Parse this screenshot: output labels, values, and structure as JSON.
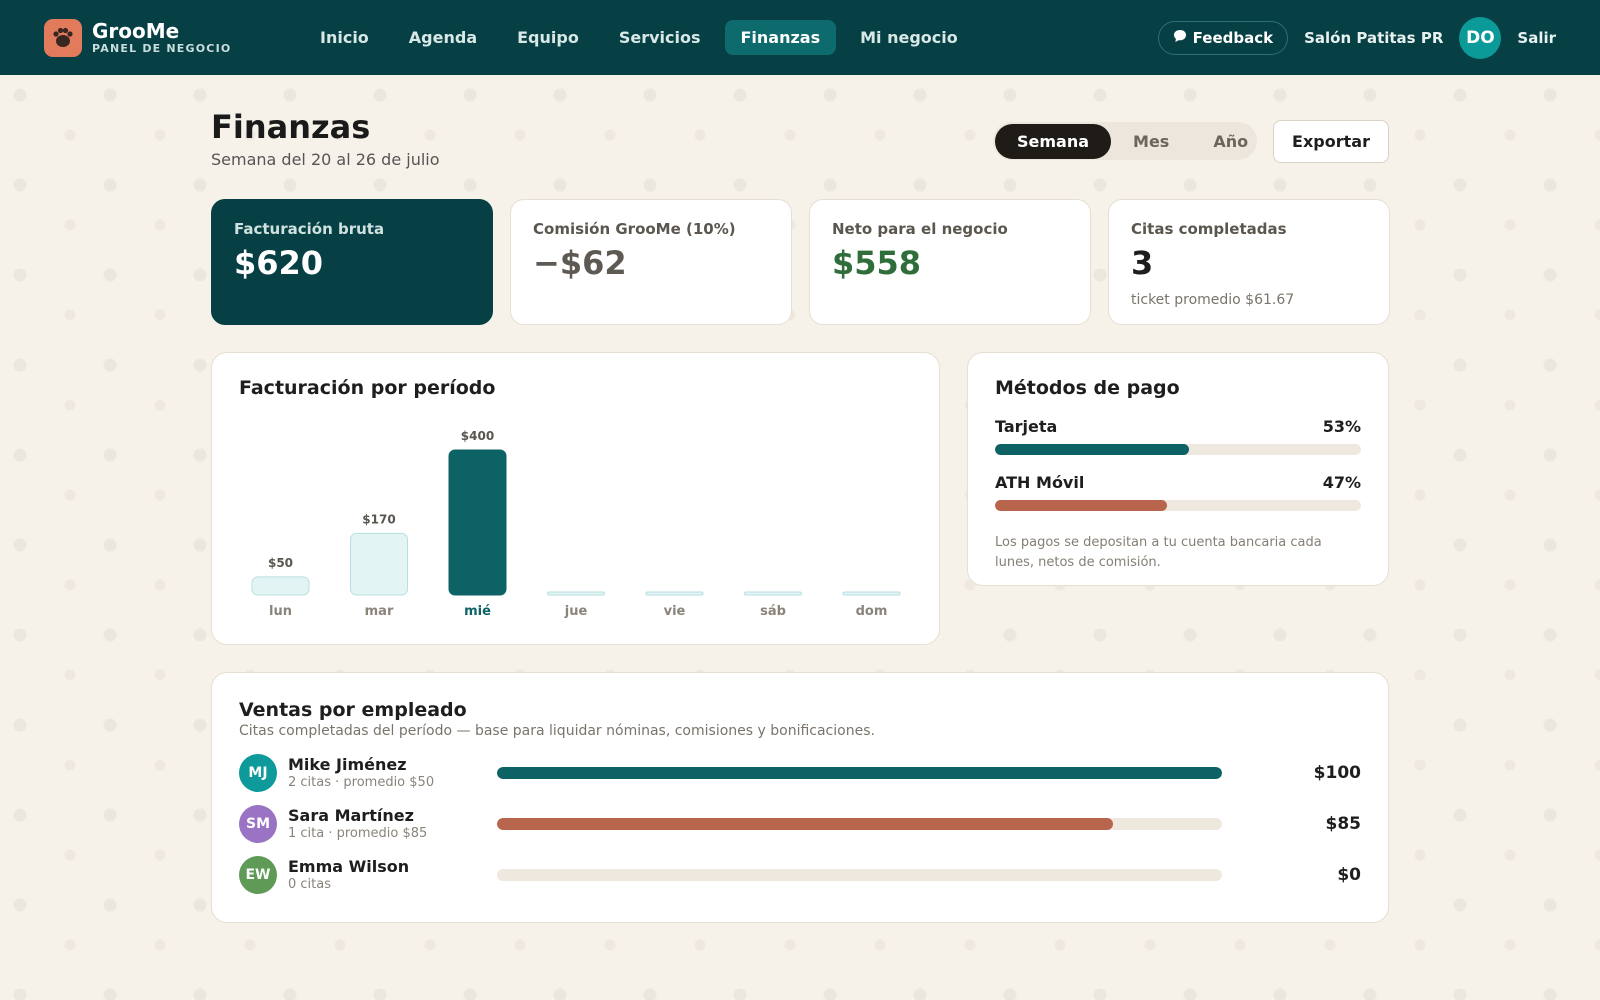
{
  "brand": {
    "name": "GrooMe",
    "subtitle": "PANEL DE NEGOCIO"
  },
  "nav": [
    {
      "label": "Inicio",
      "active": false
    },
    {
      "label": "Agenda",
      "active": false
    },
    {
      "label": "Equipo",
      "active": false
    },
    {
      "label": "Servicios",
      "active": false
    },
    {
      "label": "Finanzas",
      "active": true
    },
    {
      "label": "Mi negocio",
      "active": false
    }
  ],
  "topbar": {
    "feedback_label": "Feedback",
    "feedback_icon": "chat-bubble-icon",
    "business_name": "Salón Patitas PR",
    "avatar_initials": "DO",
    "logout_label": "Salir"
  },
  "page": {
    "title": "Finanzas",
    "subtitle": "Semana del 20 al 26 de julio",
    "period_options": [
      {
        "label": "Semana",
        "active": true
      },
      {
        "label": "Mes",
        "active": false
      },
      {
        "label": "Año",
        "active": false
      }
    ],
    "export_label": "Exportar"
  },
  "kpis": [
    {
      "label": "Facturación bruta",
      "value": "$620",
      "note": ""
    },
    {
      "label": "Comisión GrooMe (10%)",
      "value": "−$62",
      "note": ""
    },
    {
      "label": "Neto para el negocio",
      "value": "$558",
      "note": ""
    },
    {
      "label": "Citas completadas",
      "value": "3",
      "note": "ticket promedio $61.67"
    }
  ],
  "colors": {
    "primary": "#063f44",
    "teal": "#0d6266",
    "teal_light": "#e3f4f4",
    "terracotta": "#b9654d",
    "net_green": "#2f6e3a",
    "commission_gray": "#5e5a53"
  },
  "chart_data": {
    "type": "bar",
    "title": "Facturación por período",
    "categories": [
      "lun",
      "mar",
      "mié",
      "jue",
      "vie",
      "sáb",
      "dom"
    ],
    "values": [
      50,
      170,
      400,
      0,
      0,
      0,
      0
    ],
    "value_labels": [
      "$50",
      "$170",
      "$400",
      "",
      "",
      "",
      ""
    ],
    "highlight_index": 2,
    "ylim": [
      0,
      400
    ],
    "grid": false
  },
  "payments": {
    "title": "Métodos de pago",
    "methods": [
      {
        "name": "Tarjeta",
        "percent_label": "53%",
        "percent": 53,
        "color": "#0d6266"
      },
      {
        "name": "ATH Móvil",
        "percent_label": "47%",
        "percent": 47,
        "color": "#b9654d"
      }
    ],
    "note": "Los pagos se depositan a tu cuenta bancaria cada lunes, netos de comisión."
  },
  "employees": {
    "title": "Ventas por empleado",
    "subtitle": "Citas completadas del período — base para liquidar nóminas, comisiones y bonificaciones.",
    "max_amount": 100,
    "rows": [
      {
        "initials": "MJ",
        "name": "Mike Jiménez",
        "meta": "2 citas · promedio $50",
        "amount_label": "$100",
        "amount": 100,
        "avatar_color": "#0e9a9a",
        "bar_color": "#0d6266"
      },
      {
        "initials": "SM",
        "name": "Sara Martínez",
        "meta": "1 cita · promedio $85",
        "amount_label": "$85",
        "amount": 85,
        "avatar_color": "#9a73c4",
        "bar_color": "#b9654d"
      },
      {
        "initials": "EW",
        "name": "Emma Wilson",
        "meta": "0 citas",
        "amount_label": "$0",
        "amount": 0,
        "avatar_color": "#5f9b57",
        "bar_color": "#0d6266"
      }
    ]
  }
}
